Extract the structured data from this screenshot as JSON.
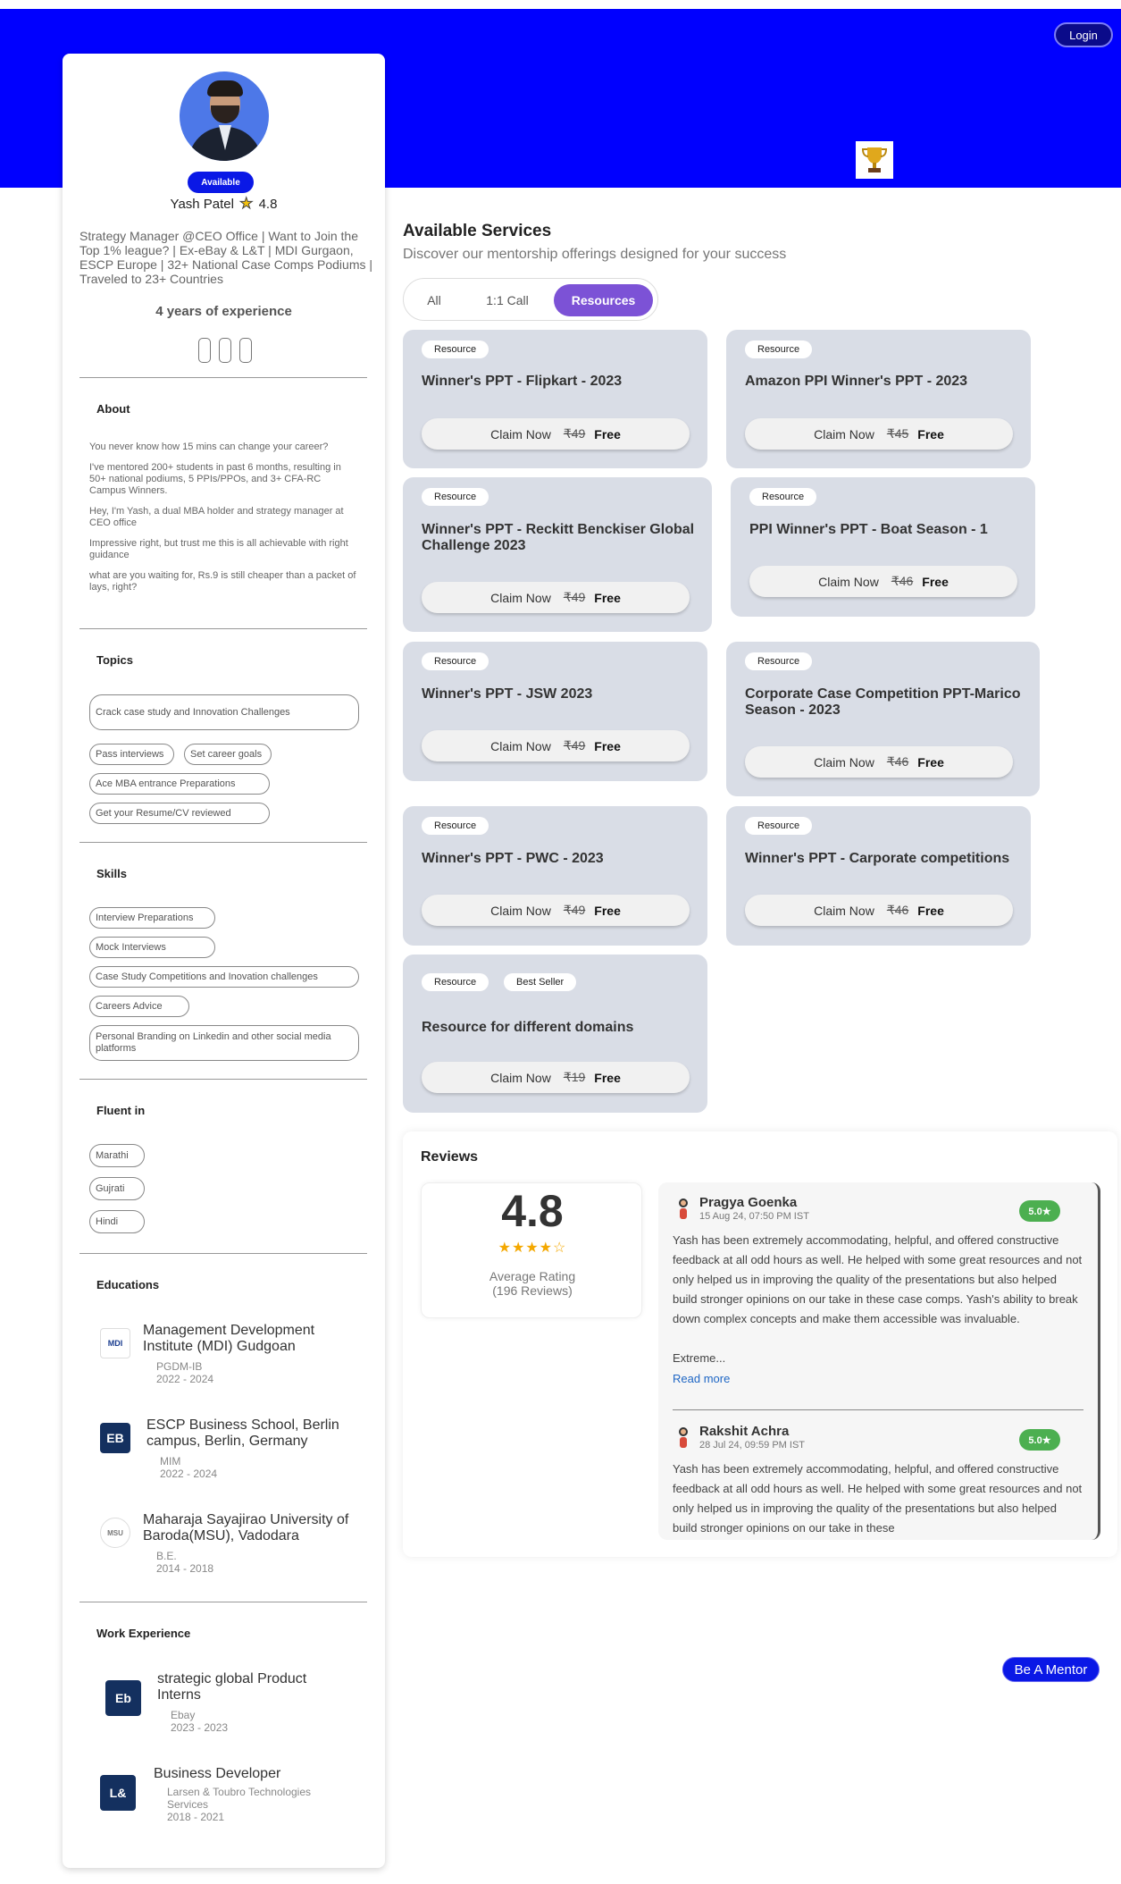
{
  "header": {
    "login_label": "Login",
    "trophy_icon": "trophy-icon"
  },
  "profile": {
    "status": "Available",
    "name": "Yash Patel",
    "rating": "4.8",
    "bio": "Strategy Manager @CEO Office | Want to Join the Top 1% league? | Ex-eBay & L&T | MDI Gurgaon, ESCP Europe | 32+ National Case Comps Podiums | Traveled to 23+ Countries",
    "experience": "4 years of experience"
  },
  "about": {
    "title": "About",
    "paragraphs": [
      "You never know how 15 mins can change your career?",
      "I've mentored 200+ students in past 6 months, resulting in 50+ national podiums, 5 PPIs/PPOs, and 3+ CFA-RC Campus Winners.",
      "Hey, I'm Yash, a dual MBA holder and strategy manager at CEO office",
      "Impressive right, but trust me this is all achievable with right guidance",
      "what are you waiting for, Rs.9 is still cheaper than a packet of lays, right?"
    ]
  },
  "topics": {
    "title": "Topics",
    "items": [
      "Crack case study and Innovation Challenges",
      "Pass interviews",
      "Set career goals",
      "Ace MBA entrance Preparations",
      "Get your Resume/CV reviewed"
    ]
  },
  "skills": {
    "title": "Skills",
    "items": [
      "Interview Preparations",
      "Mock Interviews",
      "Case Study Competitions and Inovation challenges",
      "Careers Advice",
      "Personal Branding on Linkedin and other social media platforms"
    ]
  },
  "languages": {
    "title": "Fluent in",
    "items": [
      "Marathi",
      "Gujrati",
      "Hindi"
    ]
  },
  "education": {
    "title": "Educations",
    "items": [
      {
        "logo": "MDI",
        "name": "Management Development Institute (MDI) Gudgoan",
        "degree": "PGDM-IB",
        "years": "2022 - 2024"
      },
      {
        "logo": "EB",
        "name": "ESCP Business School, Berlin campus, Berlin, Germany",
        "degree": "MIM",
        "years": "2022 - 2024"
      },
      {
        "logo": "MSU",
        "name": "Maharaja Sayajirao University of Baroda(MSU), Vadodara",
        "degree": "B.E.",
        "years": "2014 - 2018"
      }
    ]
  },
  "work": {
    "title": "Work Experience",
    "items": [
      {
        "logo": "Eb",
        "role": "strategic global Product Interns",
        "company": "Ebay",
        "years": "2023 - 2023"
      },
      {
        "logo": "L&",
        "role": "Business Developer",
        "company": "Larsen & Toubro Technologies Services",
        "years": "2018 - 2021"
      }
    ]
  },
  "services": {
    "title": "Available Services",
    "subtitle": "Discover our mentorship offerings designed for your success",
    "tabs": [
      "All",
      "1:1 Call",
      "Resources"
    ],
    "active_tab": "Resources",
    "claim_label": "Claim Now",
    "free_label": "Free",
    "cards": [
      {
        "badges": [
          "Resource"
        ],
        "title": "Winner's PPT - Flipkart - 2023",
        "price": "₹49"
      },
      {
        "badges": [
          "Resource"
        ],
        "title": "Amazon PPI Winner's PPT - 2023",
        "price": "₹45"
      },
      {
        "badges": [
          "Resource"
        ],
        "title": "Winner's PPT - Reckitt Benckiser Global Challenge 2023",
        "price": "₹49"
      },
      {
        "badges": [
          "Resource"
        ],
        "title": "PPI Winner's PPT - Boat Season - 1",
        "price": "₹46"
      },
      {
        "badges": [
          "Resource"
        ],
        "title": "Winner's PPT - JSW 2023",
        "price": "₹49"
      },
      {
        "badges": [
          "Resource"
        ],
        "title": "Corporate Case Competition PPT-Marico Season - 2023",
        "price": "₹46"
      },
      {
        "badges": [
          "Resource"
        ],
        "title": "Winner's PPT - PWC - 2023",
        "price": "₹49"
      },
      {
        "badges": [
          "Resource"
        ],
        "title": "Winner's PPT - Carporate competitions",
        "price": "₹46"
      },
      {
        "badges": [
          "Resource",
          "Best Seller"
        ],
        "title": "Resource for different domains",
        "price": "₹19"
      }
    ]
  },
  "reviews": {
    "title": "Reviews",
    "average": "4.8",
    "stars": "★★★★☆",
    "average_label": "Average Rating",
    "count_label": "(196 Reviews)",
    "items": [
      {
        "name": "Pragya Goenka",
        "date": "15 Aug 24, 07:50 PM IST",
        "score": "5.0★",
        "text": "Yash has been extremely accommodating, helpful, and offered constructive feedback at all odd hours as well. He helped with some great resources and not only helped us in improving the quality of the presentations but also helped build stronger opinions on our take in these case comps. Yash's ability to break down complex concepts and make them accessible was invaluable.",
        "ellipsis": "Extreme...",
        "more": "Read more"
      },
      {
        "name": "Rakshit Achra",
        "date": "28 Jul 24, 09:59 PM IST",
        "score": "5.0★",
        "text": "Yash has been extremely accommodating, helpful, and offered constructive feedback at all odd hours as well. He helped with some great resources and not only helped us in improving the quality of the presentations but also helped build stronger opinions on our take in these"
      }
    ]
  },
  "footer": {
    "mentor_label": "Be A Mentor"
  }
}
